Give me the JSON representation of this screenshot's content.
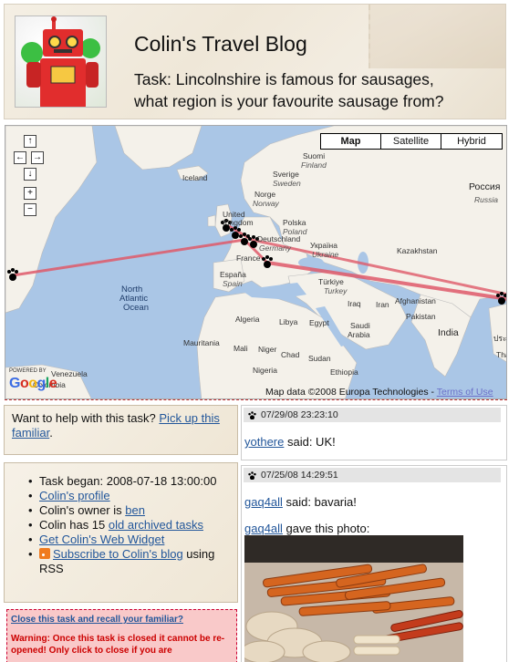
{
  "header": {
    "title": "Colin's Travel Blog",
    "task_line1": "Task: Lincolnshire is famous for sausages,",
    "task_line2": "what region is your favourite sausage from?"
  },
  "map": {
    "map_types": [
      {
        "label": "Map",
        "active": true
      },
      {
        "label": "Satellite",
        "active": false
      },
      {
        "label": "Hybrid",
        "active": false
      }
    ],
    "nav_buttons": {
      "up": "↑",
      "left": "←",
      "right": "→",
      "down": "↓",
      "zoom_in": "+",
      "zoom_out": "−"
    },
    "powered_by": "POWERED BY",
    "attribution": "Map data ©2008 Europa Technologies -",
    "terms_link": "Terms of Use",
    "labels": {
      "iceland": "Iceland",
      "suomi": "Suomi",
      "finland": "Finland",
      "sverige": "Sverige",
      "sweden": "Sweden",
      "norge": "Norge",
      "norway": "Norway",
      "russia_native": "Россия",
      "russia": "Russia",
      "uk1": "United",
      "uk2": "Kingdom",
      "polska": "Polska",
      "poland": "Poland",
      "deutschland": "Deutschland",
      "germany": "Germany",
      "ukraina_native": "Україна",
      "ukraine": "Ukraine",
      "kazakhstan": "Kazakhstan",
      "france": "France",
      "espana": "España",
      "spain": "Spain",
      "turkiye": "Türkiye",
      "turkey": "Turkey",
      "iraq": "Iraq",
      "iran": "Iran",
      "afghanistan": "Afghanistan",
      "pakistan": "Pakistan",
      "ocean1": "North",
      "ocean2": "Atlantic",
      "ocean3": "Ocean",
      "algeria": "Algeria",
      "libya": "Libya",
      "egypt": "Egypt",
      "saudi1": "Saudi",
      "saudi2": "Arabia",
      "india": "India",
      "mauritania": "Mauritania",
      "mali": "Mali",
      "niger": "Niger",
      "chad": "Chad",
      "sudan": "Sudan",
      "nigeria": "Nigeria",
      "ethiopia": "Ethiopia",
      "venezuela": "Venezuela",
      "colombia": "Colombia",
      "thai": "ประ",
      "thai2": "Thai"
    }
  },
  "help": {
    "text": "Want to help with this task?",
    "link": "Pick up this familiar",
    "period": "."
  },
  "info": {
    "began": "Task began: 2008-07-18 13:00:00",
    "profile_link": "Colin's profile",
    "owner_prefix": "Colin's owner is ",
    "owner_link": "ben",
    "archived_prefix": "Colin has 15 ",
    "archived_link": "old archived tasks",
    "widget_link": "Get Colin's Web Widget",
    "rss_link": "Subscribe to Colin's blog",
    "rss_suffix": " using RSS"
  },
  "close": {
    "link": "Close this task and recall your familiar?",
    "warning": "Warning: Once this task is closed it cannot be re-opened! Only click to close if you are"
  },
  "posts": [
    {
      "timestamp": "07/29/08 23:23:10",
      "user": "yothere",
      "said": " said: UK!"
    },
    {
      "timestamp": "07/25/08 14:29:51",
      "user": "gaq4all",
      "said": " said: bavaria!",
      "photo_user": "gaq4all",
      "photo_text": " gave this photo:"
    }
  ],
  "colors": {
    "link": "#22569a",
    "route": "#e05a6a",
    "close_bg": "#f9c9c9"
  }
}
